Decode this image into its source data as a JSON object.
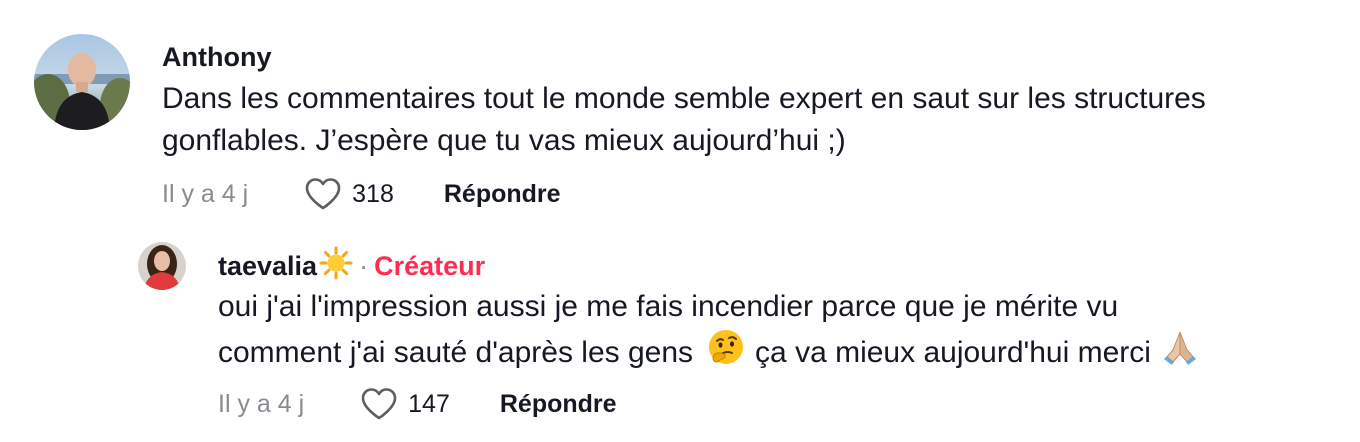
{
  "comment": {
    "username": "Anthony",
    "text_line1": "Dans les commentaires tout le monde semble expert en saut sur les structures",
    "text_line2": "gonflables. J’espère que tu vas mieux aujourd’hui ;)",
    "time": "Il y a 4 j",
    "likes": "318",
    "reply_label": "Répondre"
  },
  "reply": {
    "username": "taevalia",
    "username_emoji": "sun-emoji",
    "separator": "·",
    "badge": "Créateur",
    "badge_color": "#fe2c55",
    "text_line1": "oui j'ai l'impression aussi je me fais incendier parce que je mérite vu",
    "text_line2_a": "comment j'ai sauté d'après les gens",
    "text_line2_b": "ça va mieux aujourd'hui merci",
    "emoji_thinking": "thinking-face-emoji",
    "emoji_pray": "folded-hands-emoji",
    "time": "Il y a 4 j",
    "likes": "147",
    "reply_label": "Répondre"
  },
  "icons": {
    "heart": "heart-outline-icon"
  },
  "colors": {
    "text": "#161823",
    "muted": "#8a8b91",
    "accent": "#fe2c55"
  }
}
